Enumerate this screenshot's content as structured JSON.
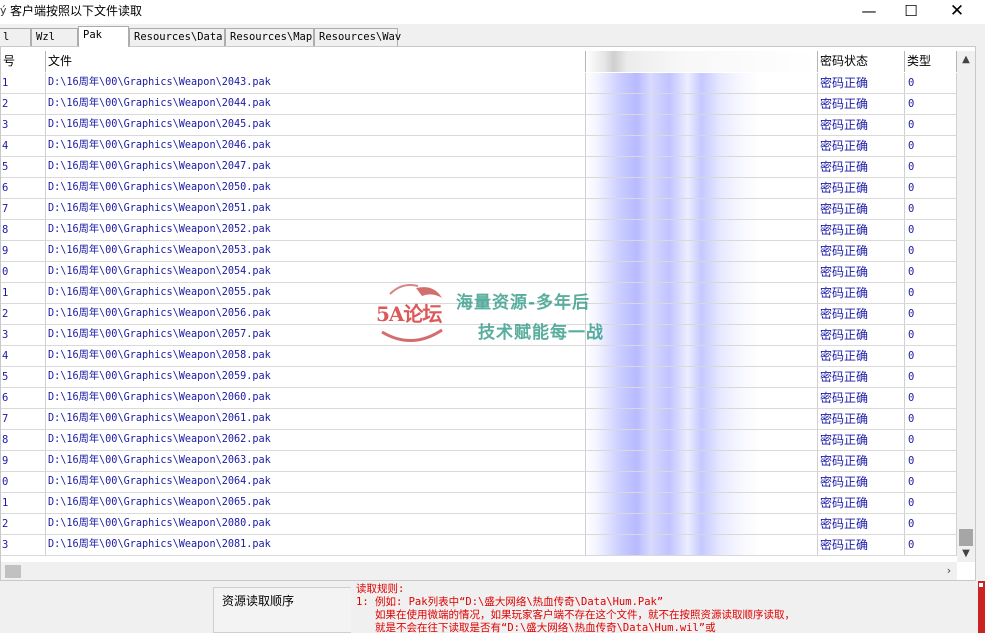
{
  "window": {
    "title": "客户端按照以下文件读取",
    "minimize_glyph": "—",
    "maximize_glyph": "☐",
    "close_glyph": "✕",
    "app_icon": "app-icon"
  },
  "tabs": [
    {
      "label": "l",
      "active": false
    },
    {
      "label": "Wzl",
      "active": false
    },
    {
      "label": "Pak",
      "active": true
    },
    {
      "label": "Resources\\Data",
      "active": false
    },
    {
      "label": "Resources\\Map",
      "active": false
    },
    {
      "label": "Resources\\Wav",
      "active": false
    }
  ],
  "table": {
    "columns": [
      "号",
      "文件",
      "",
      "密码状态",
      "类型"
    ],
    "rows": [
      {
        "no": "1",
        "file": "D:\\16周年\\00\\Graphics\\Weapon\\2043.pak",
        "status": "密码正确",
        "type": "0"
      },
      {
        "no": "2",
        "file": "D:\\16周年\\00\\Graphics\\Weapon\\2044.pak",
        "status": "密码正确",
        "type": "0"
      },
      {
        "no": "3",
        "file": "D:\\16周年\\00\\Graphics\\Weapon\\2045.pak",
        "status": "密码正确",
        "type": "0"
      },
      {
        "no": "4",
        "file": "D:\\16周年\\00\\Graphics\\Weapon\\2046.pak",
        "status": "密码正确",
        "type": "0"
      },
      {
        "no": "5",
        "file": "D:\\16周年\\00\\Graphics\\Weapon\\2047.pak",
        "status": "密码正确",
        "type": "0"
      },
      {
        "no": "6",
        "file": "D:\\16周年\\00\\Graphics\\Weapon\\2050.pak",
        "status": "密码正确",
        "type": "0"
      },
      {
        "no": "7",
        "file": "D:\\16周年\\00\\Graphics\\Weapon\\2051.pak",
        "status": "密码正确",
        "type": "0"
      },
      {
        "no": "8",
        "file": "D:\\16周年\\00\\Graphics\\Weapon\\2052.pak",
        "status": "密码正确",
        "type": "0"
      },
      {
        "no": "9",
        "file": "D:\\16周年\\00\\Graphics\\Weapon\\2053.pak",
        "status": "密码正确",
        "type": "0"
      },
      {
        "no": "0",
        "file": "D:\\16周年\\00\\Graphics\\Weapon\\2054.pak",
        "status": "密码正确",
        "type": "0"
      },
      {
        "no": "1",
        "file": "D:\\16周年\\00\\Graphics\\Weapon\\2055.pak",
        "status": "密码正确",
        "type": "0"
      },
      {
        "no": "2",
        "file": "D:\\16周年\\00\\Graphics\\Weapon\\2056.pak",
        "status": "密码正确",
        "type": "0"
      },
      {
        "no": "3",
        "file": "D:\\16周年\\00\\Graphics\\Weapon\\2057.pak",
        "status": "密码正确",
        "type": "0"
      },
      {
        "no": "4",
        "file": "D:\\16周年\\00\\Graphics\\Weapon\\2058.pak",
        "status": "密码正确",
        "type": "0"
      },
      {
        "no": "5",
        "file": "D:\\16周年\\00\\Graphics\\Weapon\\2059.pak",
        "status": "密码正确",
        "type": "0"
      },
      {
        "no": "6",
        "file": "D:\\16周年\\00\\Graphics\\Weapon\\2060.pak",
        "status": "密码正确",
        "type": "0"
      },
      {
        "no": "7",
        "file": "D:\\16周年\\00\\Graphics\\Weapon\\2061.pak",
        "status": "密码正确",
        "type": "0"
      },
      {
        "no": "8",
        "file": "D:\\16周年\\00\\Graphics\\Weapon\\2062.pak",
        "status": "密码正确",
        "type": "0"
      },
      {
        "no": "9",
        "file": "D:\\16周年\\00\\Graphics\\Weapon\\2063.pak",
        "status": "密码正确",
        "type": "0"
      },
      {
        "no": "0",
        "file": "D:\\16周年\\00\\Graphics\\Weapon\\2064.pak",
        "status": "密码正确",
        "type": "0"
      },
      {
        "no": "1",
        "file": "D:\\16周年\\00\\Graphics\\Weapon\\2065.pak",
        "status": "密码正确",
        "type": "0"
      },
      {
        "no": "2",
        "file": "D:\\16周年\\00\\Graphics\\Weapon\\2080.pak",
        "status": "密码正确",
        "type": "0"
      },
      {
        "no": "3",
        "file": "D:\\16周年\\00\\Graphics\\Weapon\\2081.pak",
        "status": "密码正确",
        "type": "0"
      }
    ]
  },
  "scrollbars": {
    "up_glyph": "▲",
    "down_glyph": "▼",
    "left_glyph": "‹",
    "right_glyph": "›"
  },
  "watermark": {
    "logo_text": "5A论坛",
    "line1": "海量资源-多年后",
    "line2": "技术赋能每一战"
  },
  "bottom": {
    "order_label": "资源读取顺序",
    "rules_title": "读取规则:",
    "rules_line1": "1: 例如: Pak列表中“D:\\盛大网络\\热血传奇\\Data\\Hum.Pak”",
    "rules_line2": "如果在使用微端的情况，如果玩家客户端不存在这个文件，就不在按照资源读取顺序读取，",
    "rules_line3": "就是不会在往下读取是否有“D:\\盛大网络\\热血传奇\\Data\\Hum.wil”或"
  },
  "colors": {
    "cell_text": "#1a1aa6",
    "rules_text": "#e00000",
    "watermark_text": "#1a8f7a",
    "watermark_logo": "#d83b3b"
  }
}
